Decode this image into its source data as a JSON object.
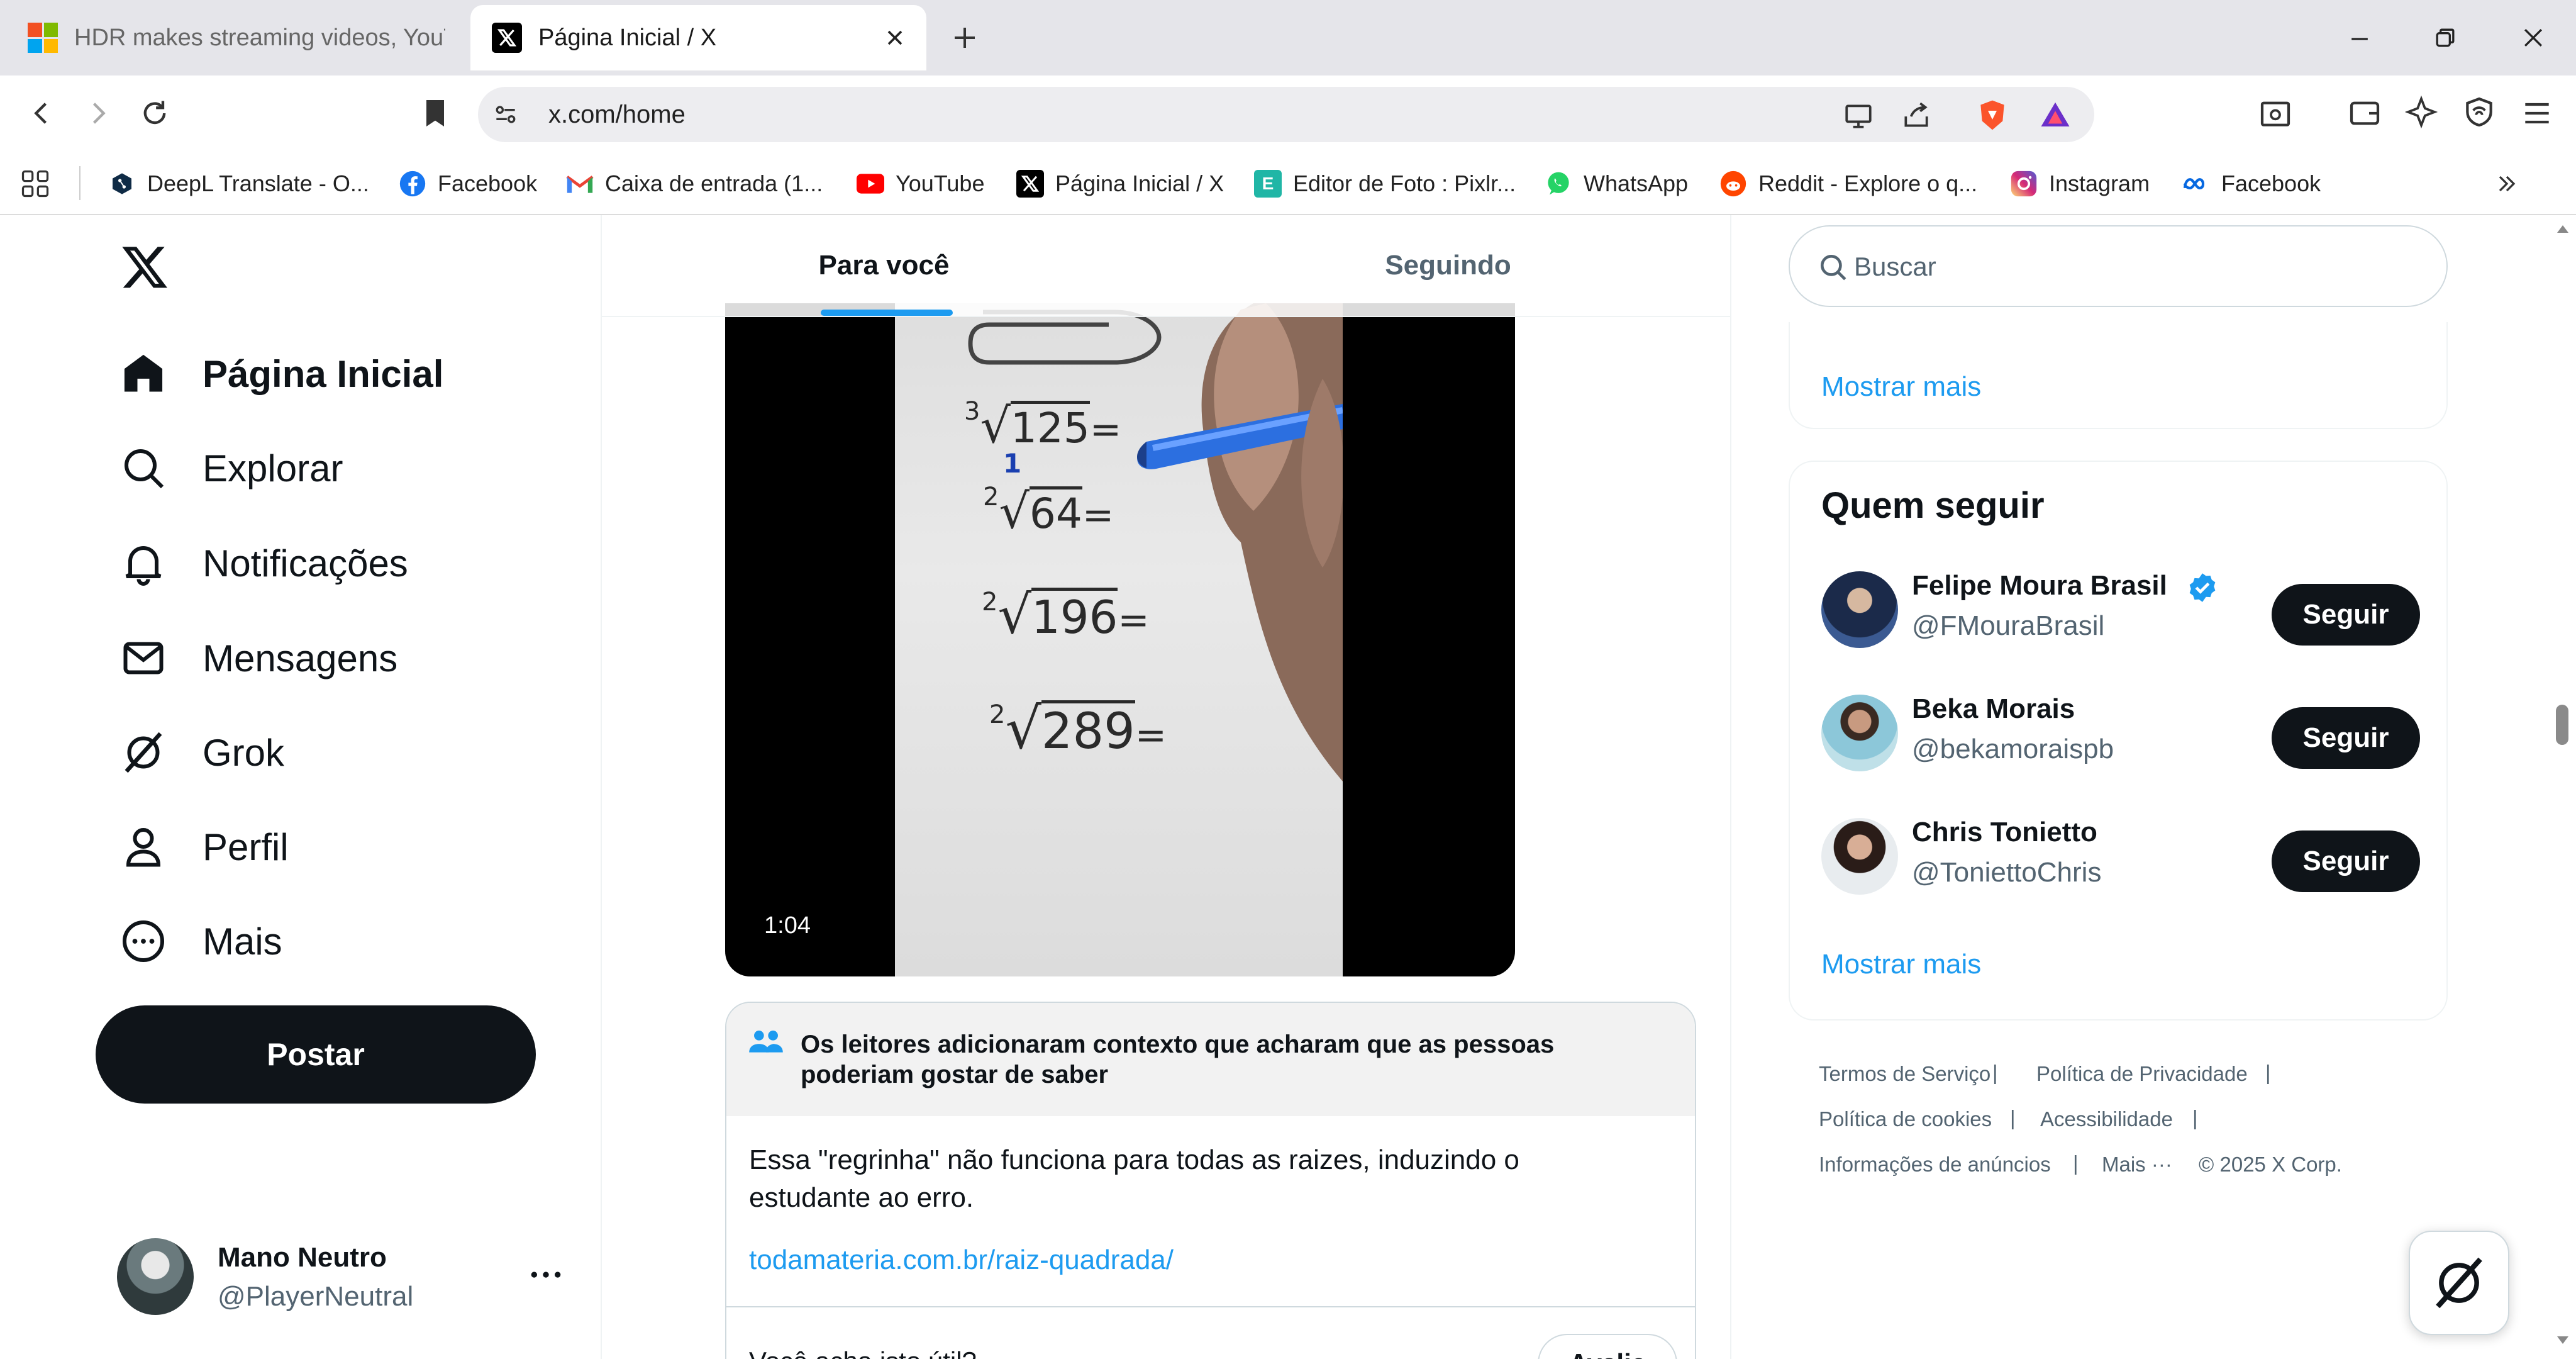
{
  "browser": {
    "tabs": [
      {
        "title": "HDR makes streaming videos, YouTub",
        "active": false,
        "icon": "windows-logo-icon"
      },
      {
        "title": "Página Inicial / X",
        "active": true,
        "icon": "x-logo-icon"
      }
    ],
    "address": "x.com/home",
    "bookmarks": [
      {
        "label": "DeepL Translate - O...",
        "icon": "deepl-icon"
      },
      {
        "label": "Facebook",
        "icon": "facebook-icon"
      },
      {
        "label": "Caixa de entrada (1...",
        "icon": "gmail-icon"
      },
      {
        "label": "YouTube",
        "icon": "youtube-icon"
      },
      {
        "label": "Página Inicial / X",
        "icon": "x-logo-icon"
      },
      {
        "label": "Editor de Foto : Pixlr...",
        "icon": "pixlr-icon"
      },
      {
        "label": "WhatsApp",
        "icon": "whatsapp-icon"
      },
      {
        "label": "Reddit - Explore o q...",
        "icon": "reddit-icon"
      },
      {
        "label": "Instagram",
        "icon": "instagram-icon"
      },
      {
        "label": "Facebook",
        "icon": "meta-icon"
      }
    ]
  },
  "sidebar": {
    "items": [
      {
        "label": "Página Inicial",
        "icon": "home-icon"
      },
      {
        "label": "Explorar",
        "icon": "search-icon"
      },
      {
        "label": "Notificações",
        "icon": "bell-icon"
      },
      {
        "label": "Mensagens",
        "icon": "mail-icon"
      },
      {
        "label": "Grok",
        "icon": "grok-icon"
      },
      {
        "label": "Perfil",
        "icon": "profile-icon"
      },
      {
        "label": "Mais",
        "icon": "more-circle-icon"
      }
    ],
    "post_label": "Postar",
    "account": {
      "name": "Mano Neutro",
      "handle": "@PlayerNeutral"
    }
  },
  "timeline": {
    "tabs": [
      {
        "label": "Para você",
        "active": true
      },
      {
        "label": "Seguindo",
        "active": false
      }
    ],
    "video": {
      "duration": "1:04",
      "equations": [
        {
          "index": "3",
          "radicand": "125",
          "suffix": "="
        },
        {
          "index": "2",
          "radicand": "64",
          "suffix": "="
        },
        {
          "index": "2",
          "radicand": "196",
          "suffix": "="
        },
        {
          "index": "2",
          "radicand": "289",
          "suffix": "="
        }
      ],
      "handwritten_digit": "1"
    },
    "community_note": {
      "header": "Os leitores adicionaram contexto que acharam que as pessoas poderiam gostar de saber",
      "body": "Essa \"regrinha\" não funciona para todas as raizes, induzindo o estudante ao erro.",
      "link": "todamateria.com.br/raiz-quadrada/",
      "question": "Você acha isto útil?",
      "rate_label": "Avalie"
    }
  },
  "right": {
    "search_placeholder": "Buscar",
    "show_more_top": "Mostrar mais",
    "who_to_follow": {
      "title": "Quem seguir",
      "users": [
        {
          "name": "Felipe Moura Brasil",
          "handle": "@FMouraBrasil",
          "verified": true,
          "button": "Seguir"
        },
        {
          "name": "Beka Morais",
          "handle": "@bekamoraispb",
          "verified": false,
          "button": "Seguir"
        },
        {
          "name": "Chris Tonietto",
          "handle": "@ToniettoChris",
          "verified": false,
          "button": "Seguir"
        }
      ],
      "show_more": "Mostrar mais"
    },
    "footer": {
      "links": [
        "Termos de Serviço",
        "Política de Privacidade",
        "Política de cookies",
        "Acessibilidade",
        "Informações de anúncios",
        "Mais ···"
      ],
      "copyright": "© 2025 X Corp."
    }
  },
  "colors": {
    "accent": "#1d9bf0",
    "dark": "#0f1419",
    "muted": "#536471"
  }
}
